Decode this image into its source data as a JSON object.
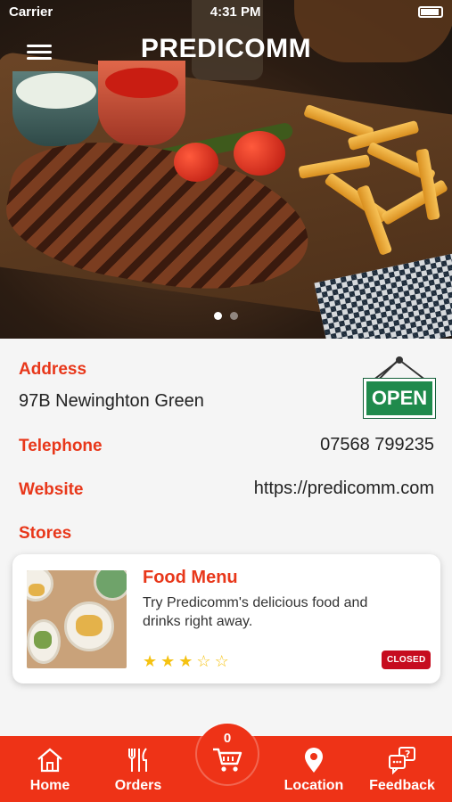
{
  "status_bar": {
    "carrier": "Carrier",
    "time": "4:31 PM"
  },
  "header": {
    "title": "PREDICOMM",
    "menu_icon": "hamburger-icon"
  },
  "carousel": {
    "pages": 2,
    "active_index": 0
  },
  "info": {
    "address_label": "Address",
    "address_value": "97B Newinghton Green",
    "open_sign": "OPEN",
    "telephone_label": "Telephone",
    "telephone_value": "07568 799235",
    "website_label": "Website",
    "website_value": "https://predicomm.com",
    "stores_label": "Stores"
  },
  "stores": [
    {
      "title": "Food Menu",
      "description": "Try Predicomm's delicious food and drinks right away.",
      "rating": 3,
      "rating_max": 5,
      "status": "CLOSED"
    }
  ],
  "tabbar": {
    "items": [
      {
        "label": "Home",
        "icon": "home-icon"
      },
      {
        "label": "Orders",
        "icon": "cutlery-icon"
      },
      {
        "label": "Location",
        "icon": "location-pin-icon"
      },
      {
        "label": "Feedback",
        "icon": "feedback-icon"
      }
    ],
    "cart_count": "0",
    "cart_icon": "cart-icon"
  },
  "colors": {
    "accent": "#ee3317",
    "label": "#e8371a",
    "open_green": "#1f8a4c",
    "closed_red": "#c60c1f",
    "star": "#f5c211"
  }
}
